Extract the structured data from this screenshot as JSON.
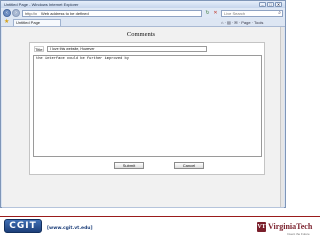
{
  "window": {
    "title": "Untitled Page - Windows Internet Explorer",
    "controls": {
      "minimize": "–",
      "maximize": "□",
      "close": "✕"
    }
  },
  "address_bar": {
    "prefix": "http://x",
    "value": "Web address to be defined",
    "search_placeholder": "Live Search"
  },
  "tabs": [
    {
      "label": "Untitled Page"
    }
  ],
  "toolbar": {
    "commands": "⌂ · ▤ · ✉ · Page · Tools"
  },
  "page": {
    "heading": "Comments",
    "title_label": "Title:",
    "title_value": "I love this website, However",
    "comment_text": "the interface could be further improved by",
    "submit_label": "Submit",
    "cancel_label": "Cancel"
  },
  "footer": {
    "logo_text": "CGIT",
    "url": "[www.cgit.vt.edu]",
    "university": "VirginiaTech",
    "tagline": "Invent the Future"
  },
  "colors": {
    "vt_maroon": "#7a1f2b",
    "cgit_blue": "#1d3f7a"
  }
}
